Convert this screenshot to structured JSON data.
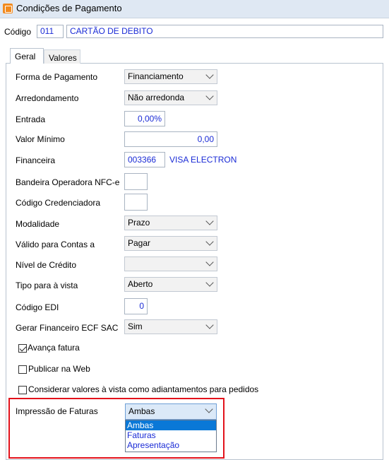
{
  "window": {
    "title": "Condições de Pagamento",
    "icon": "app-icon",
    "accent": "#f28a1e"
  },
  "header": {
    "codigo_label": "Código",
    "codigo_value": "011",
    "descricao_value": "CARTÃO DE DEBITO"
  },
  "tabs": [
    {
      "label": "Geral",
      "active": true
    },
    {
      "label": "Valores",
      "active": false
    }
  ],
  "fields": {
    "forma_pagamento": {
      "label": "Forma de Pagamento",
      "value": "Financiamento"
    },
    "arredondamento": {
      "label": "Arredondamento",
      "value": "Não arredonda"
    },
    "entrada": {
      "label": "Entrada",
      "value": "0,00%"
    },
    "valor_minimo": {
      "label": "Valor Mínimo",
      "value": "0,00"
    },
    "financeira": {
      "label": "Financeira",
      "code": "003366",
      "name": "VISA ELECTRON"
    },
    "bandeira": {
      "label": "Bandeira Operadora NFC-e",
      "value": ""
    },
    "credenciadora": {
      "label": "Código Credenciadora",
      "value": ""
    },
    "modalidade": {
      "label": "Modalidade",
      "value": "Prazo"
    },
    "valido_contas": {
      "label": "Válido para Contas a",
      "value": "Pagar"
    },
    "nivel_credito": {
      "label": "Nível de Crédito",
      "value": ""
    },
    "tipo_vista": {
      "label": "Tipo para à vista",
      "value": "Aberto"
    },
    "codigo_edi": {
      "label": "Código EDI",
      "value": "0"
    },
    "gerar_financeiro": {
      "label": "Gerar Financeiro ECF SAC",
      "value": "Sim"
    },
    "impressao_faturas": {
      "label": "Impressão de Faturas",
      "value": "Ambas",
      "options": [
        "Ambas",
        "Faturas",
        "Apresentação"
      ],
      "highlighted": "Ambas"
    }
  },
  "checkboxes": {
    "avanca_fatura": {
      "label": "Avança fatura",
      "checked": true
    },
    "publicar_web": {
      "label": "Publicar na Web",
      "checked": false
    },
    "considerar_valores": {
      "label": "Considerar valores à vista como adiantamentos para pedidos",
      "checked": false
    }
  },
  "colors": {
    "highlight_box": "#e3121b",
    "selection": "#0a78d7",
    "value_text": "#1a2bd6"
  }
}
